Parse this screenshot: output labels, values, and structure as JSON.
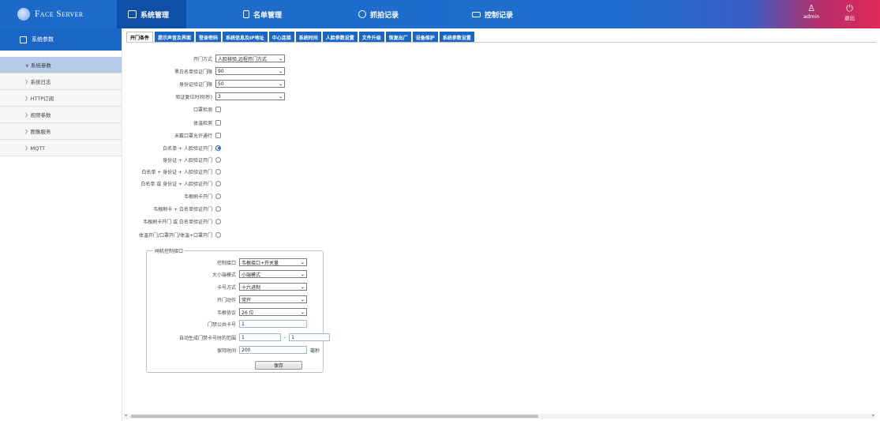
{
  "app": {
    "logo_text": "Face Server"
  },
  "nav": [
    {
      "label": "系统管理",
      "icon": "monitor-icon"
    },
    {
      "label": "名单管理",
      "icon": "list-icon"
    },
    {
      "label": "抓拍记录",
      "icon": "camera-icon"
    },
    {
      "label": "控制记录",
      "icon": "control-icon"
    }
  ],
  "user": {
    "name": "admin",
    "logout": "退出"
  },
  "sidebar": {
    "header": "系统参数",
    "items": [
      {
        "label": "∨ 系统参数"
      },
      {
        "label": "〉系统日志"
      },
      {
        "label": "〉HTTP订阅"
      },
      {
        "label": "〉视频参数"
      },
      {
        "label": "〉图像服务"
      },
      {
        "label": "〉MQTT"
      }
    ]
  },
  "tabs": [
    "开门条件",
    "提示声音及界面",
    "登录密码",
    "系统信息及IP地址",
    "中心连接",
    "系统时间",
    "人脸参数设置",
    "文件升级",
    "恢复出厂",
    "设备维护",
    "系统参数设置"
  ],
  "form": {
    "selects": [
      {
        "label": "开门方式",
        "value": "人脸核验,远程开门方式"
      },
      {
        "label": "黑白名单验证门限",
        "value": "90"
      },
      {
        "label": "身份证验证门限",
        "value": "50"
      },
      {
        "label": "验证复位时间(秒)",
        "value": "3"
      }
    ],
    "checkboxes": [
      {
        "label": "口罩检测",
        "checked": false
      },
      {
        "label": "体温检测",
        "checked": false
      },
      {
        "label": "未戴口罩允许通行",
        "checked": false
      }
    ],
    "radios": [
      {
        "label": "白名单 + 人脸验证开门",
        "checked": true
      },
      {
        "label": "身份证 + 人脸验证开门",
        "checked": false
      },
      {
        "label": "白名单 + 身份证 + 人脸验证开门",
        "checked": false
      },
      {
        "label": "白名单 或 身份证 + 人脸验证开门",
        "checked": false
      },
      {
        "label": "韦根刷卡开门",
        "checked": false
      },
      {
        "label": "韦根刷卡 + 白名单验证开门",
        "checked": false
      },
      {
        "label": "韦根刷卡开门 或 白名单验证开门",
        "checked": false
      },
      {
        "label": "体温开门/口罩开门/体温+口罩开门",
        "checked": false
      }
    ]
  },
  "gate": {
    "legend": "闸机控制接口",
    "selects": [
      {
        "label": "控制接口",
        "value": "韦根接口+开关量"
      },
      {
        "label": "大小端模式",
        "value": "小端模式"
      },
      {
        "label": "卡号方式",
        "value": "十六进制"
      },
      {
        "label": "开门动作",
        "value": "常开"
      },
      {
        "label": "韦根协议",
        "value": "26 位"
      }
    ],
    "card_label": "门禁公共卡号",
    "card_value": "1",
    "range_label": "自动生成门禁卡号时的范围",
    "range_from": "1",
    "range_sep": "-",
    "range_to": "1",
    "hold_label": "保持时间",
    "hold_value": "200",
    "hold_unit": "毫秒",
    "save": "保存"
  }
}
